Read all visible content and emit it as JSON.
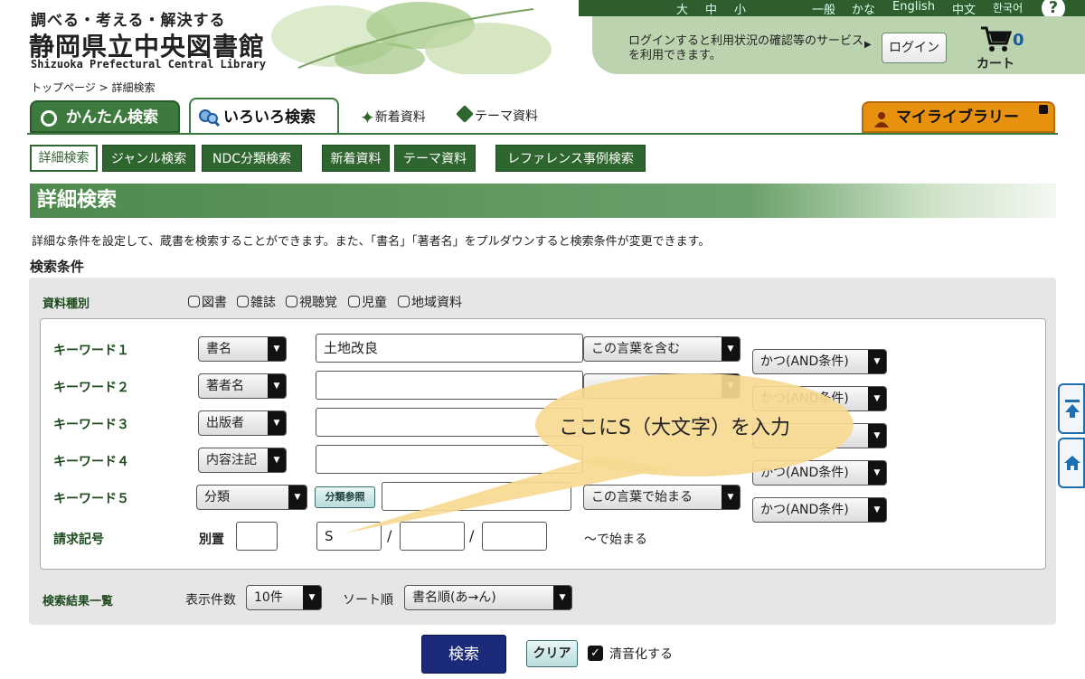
{
  "header": {
    "slogan": "調べる・考える・解決する",
    "library_name": "静岡県立中央図書館",
    "library_name_en": "Shizuoka Prefectural Central Library",
    "font_sizes": [
      "大",
      "中",
      "小"
    ],
    "languages": [
      "一般",
      "かな",
      "English",
      "中文",
      "한국어"
    ],
    "login_message": "ログインすると利用状況の確認等のサービスを利用できます。",
    "login_button": "ログイン",
    "cart_count": "0",
    "cart_label": "カート"
  },
  "breadcrumb": "トップページ > 詳細検索",
  "tabs": {
    "simple": "かんたん検索",
    "various": "いろいろ検索",
    "new_items": "新着資料",
    "theme": "テーマ資料",
    "my_library": "マイライブラリー"
  },
  "subnav": [
    "詳細検索",
    "ジャンル検索",
    "NDC分類検索",
    "新着資料",
    "テーマ資料",
    "レファレンス事例検索"
  ],
  "section": {
    "title": "詳細検索",
    "description": "詳細な条件を設定して、蔵書を検索することができます。また、「書名」「著者名」をプルダウンすると検索条件が変更できます。",
    "conditions_title": "検索条件"
  },
  "material": {
    "label": "資料種別",
    "types": [
      "図書",
      "雑誌",
      "視聴覚",
      "児童",
      "地域資料"
    ]
  },
  "keywords": [
    {
      "label": "キーワード１",
      "field": "書名",
      "value": "土地改良",
      "match": "この言葉を含む",
      "logic": "かつ(AND条件)"
    },
    {
      "label": "キーワード２",
      "field": "著者名",
      "value": "",
      "match": "",
      "logic": "かつ(AND条件)"
    },
    {
      "label": "キーワード３",
      "field": "出版者",
      "value": "",
      "match": "",
      "logic": ""
    },
    {
      "label": "キーワード４",
      "field": "内容注記",
      "value": "",
      "match": "",
      "logic": "かつ(AND条件)"
    },
    {
      "label": "キーワード５",
      "field": "分類",
      "value": "",
      "match": "この言葉で始まる",
      "logic": "かつ(AND条件)"
    }
  ],
  "classification_ref_button": "分類参照",
  "call_number": {
    "label": "請求記号",
    "separate_label": "別置",
    "separate_value": "",
    "part1": "S",
    "part2": "",
    "part3": "",
    "suffix": "〜で始まる"
  },
  "results": {
    "label": "検索結果一覧",
    "count_label": "表示件数",
    "count_value": "10件",
    "sort_label": "ソート順",
    "sort_value": "書名順(あ→ん)"
  },
  "actions": {
    "search": "検索",
    "clear": "クリア",
    "normalize_label": "清音化する"
  },
  "callout": "ここにS（大文字）を入力",
  "colors": {
    "brand_green": "#2f652f",
    "search_button": "#1c2a7a",
    "my_library": "#e8910f",
    "callout": "#f6d991"
  }
}
